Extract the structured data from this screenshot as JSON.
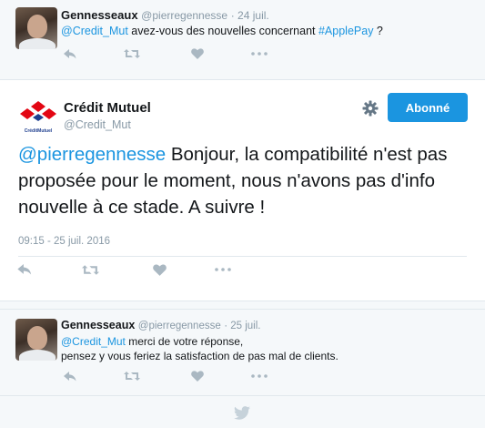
{
  "tweet1": {
    "name": "Gennesseaux",
    "handle": "@pierregennesse",
    "date": "24 juil.",
    "mention": "@Credit_Mut",
    "text_middle": " avez-vous des nouvelles concernant ",
    "hashtag": "#ApplePay",
    "text_end": " ?"
  },
  "main_tweet": {
    "name": "Crédit Mutuel",
    "handle": "@Credit_Mut",
    "logo_caption": "CréditMutuel",
    "follow_label": "Abonné",
    "mention": "@pierregennesse",
    "text": " Bonjour, la compatibilité n'est pas proposée pour le moment, nous n'avons pas d'info nouvelle à ce stade. A suivre !",
    "timestamp": "09:15 - 25 juil. 2016"
  },
  "tweet3": {
    "name": "Gennesseaux",
    "handle": "@pierregennesse",
    "date": "25 juil.",
    "mention": "@Credit_Mut",
    "text_line1": " merci de votre réponse,",
    "text_line2": "pensez y vous feriez la satisfaction de pas mal de clients."
  },
  "icons": [
    "reply-icon",
    "retweet-icon",
    "like-icon",
    "more-icon",
    "gear-icon",
    "twitter-bird-icon"
  ],
  "colors": {
    "accent": "#1b95e0",
    "muted": "#8899a6",
    "icon": "#aab8c2",
    "background": "#f5f8fa"
  }
}
